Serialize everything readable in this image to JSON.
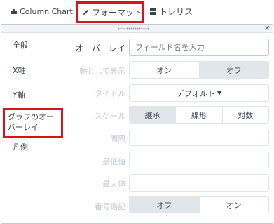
{
  "toolbar": {
    "column_chart": "Column Chart",
    "format": "フォーマット",
    "trellis": "トレリス"
  },
  "panel": {
    "close": "×"
  },
  "sidebar": {
    "items": [
      {
        "label": "全般"
      },
      {
        "label": "X軸"
      },
      {
        "label": "Y軸"
      },
      {
        "label": "グラフのオーバーレイ"
      },
      {
        "label": "凡例"
      }
    ]
  },
  "form": {
    "overlay_label": "オーバーレイ",
    "overlay_placeholder": "フィールド名を入力",
    "display_as_axis_label": "軸として表示",
    "display_as_axis_options": [
      "オン",
      "オフ"
    ],
    "display_as_axis_selected": "オフ",
    "title_label": "タイトル",
    "title_value": "デフォルト",
    "scale_label": "スケール",
    "scale_options": [
      "継承",
      "線形",
      "対数"
    ],
    "scale_selected": "継承",
    "interval_label": "間隔",
    "min_label": "最低値",
    "max_label": "最大値",
    "abbrev_label": "番号略記",
    "abbrev_options": [
      "オフ",
      "オン"
    ],
    "abbrev_selected": "オフ"
  },
  "colors": {
    "highlight": "#d9121f",
    "selected_segment": "#e1e6eb",
    "text": "#3c444d",
    "disabled_text": "#c3cbd4"
  }
}
